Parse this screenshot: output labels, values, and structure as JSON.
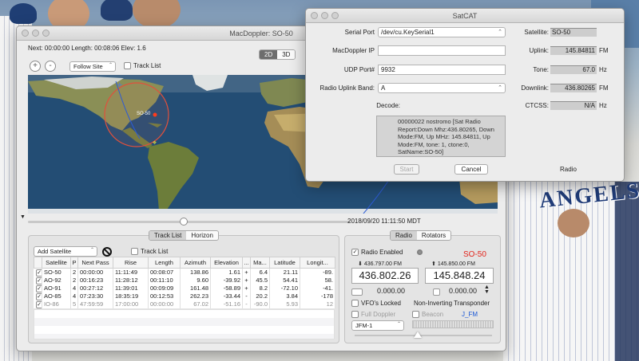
{
  "macdoppler": {
    "title": "MacDoppler: SO-50",
    "info_line": "Next: 00:00:00 Length: 00:08:06 Elev: 1.6",
    "view_2d": "2D",
    "view_3d": "3D",
    "zoom_in": "+",
    "zoom_out": "-",
    "follow_site": "Follow Site",
    "track_list_map": "Track List",
    "timestamp": "2018/09/20 11:11:50 MDT",
    "map_satellite_label": "SO-50",
    "track_tabs": [
      "Track List",
      "Horizon"
    ],
    "add_satellite": "Add Satellite",
    "track_list_check": "Track List",
    "table": {
      "headers": [
        "",
        "Satellite",
        "P",
        "Next Pass",
        "Rise",
        "Length",
        "Azimuth",
        "Elevation",
        "...",
        "Ma...",
        "Latitude",
        "Longit..."
      ],
      "rows": [
        [
          "SO-50",
          "2",
          "00:00:00",
          "11:11:49",
          "00:08:07",
          "138.86",
          "1.61",
          "+",
          "6.4",
          "21.11",
          "-89."
        ],
        [
          "AO-92",
          "2",
          "00:16:23",
          "11:28:12",
          "00:11:10",
          "9.60",
          "-39.92",
          "+",
          "45.5",
          "54.41",
          "58."
        ],
        [
          "AO-91",
          "4",
          "00:27:12",
          "11:39:01",
          "00:09:09",
          "161.48",
          "-58.89",
          "+",
          "8.2",
          "-72.10",
          "-41."
        ],
        [
          "AO-85",
          "4",
          "07:23:30",
          "18:35:19",
          "00:12:53",
          "262.23",
          "-33.44",
          "-",
          "20.2",
          "3.84",
          "-178"
        ],
        [
          "IO-86",
          "5",
          "47:59:59",
          "17:00:00",
          "00:00:00",
          "67.02",
          "-51.16",
          "-",
          "-90.0",
          "5.93",
          "12"
        ]
      ]
    },
    "radio_tabs": [
      "Radio",
      "Rotators"
    ],
    "radio_enabled": "Radio Enabled",
    "radio_sat_name": "SO-50",
    "downlink_label": "436.797.00 FM",
    "uplink_label": "145.850.00 FM",
    "downlink_freq": "436.802.26",
    "uplink_freq": "145.848.24",
    "offset_left": "0.000.00",
    "offset_right": "0.000.00",
    "vfos_locked": "VFO's Locked",
    "transponder": "Non-Inverting Transponder",
    "full_doppler": "Full Doppler",
    "beacon": "Beacon",
    "j_fm": "J_FM",
    "mode_select": "JFM-1"
  },
  "satcat": {
    "title": "SatCAT",
    "serial_port_label": "Serial Port",
    "serial_port_value": "/dev/cu.KeySerial1",
    "macdoppler_ip_label": "MacDoppler IP",
    "macdoppler_ip_value": "",
    "udp_port_label": "UDP Port#",
    "udp_port_value": "9932",
    "uplink_band_label": "Radio Uplink Band:",
    "uplink_band_value": "A",
    "decode_label": "Decode:",
    "decode_text": "00000022 nostromo [Sat Radio Report:Down Mhz:436.80265, Down Mode:FM, Up MHz: 145.84811, Up Mode:FM, tone: 1, ctone:0, SatName:SO-50]",
    "satellite_label": "Satellite:",
    "satellite_value": "SO-50",
    "uplink_label": "Uplink:",
    "uplink_value": "145.84811",
    "uplink_unit": "FM",
    "tone_label": "Tone:",
    "tone_value": "67.0",
    "tone_unit": "Hz",
    "downlink_label": "Downlink:",
    "downlink_value": "436.80265",
    "downlink_unit": "FM",
    "ctcss_label": "CTCSS:",
    "ctcss_value": "N/A",
    "ctcss_unit": "Hz",
    "start_button": "Start",
    "cancel_button": "Cancel",
    "radio_label": "Radio"
  },
  "background": {
    "jersey_letters": "ANGELS"
  },
  "colors": {
    "accent_red": "#e2231a",
    "link_blue": "#1a57d6",
    "ocean": "#1f4a72",
    "land": "#7d8a4e"
  }
}
